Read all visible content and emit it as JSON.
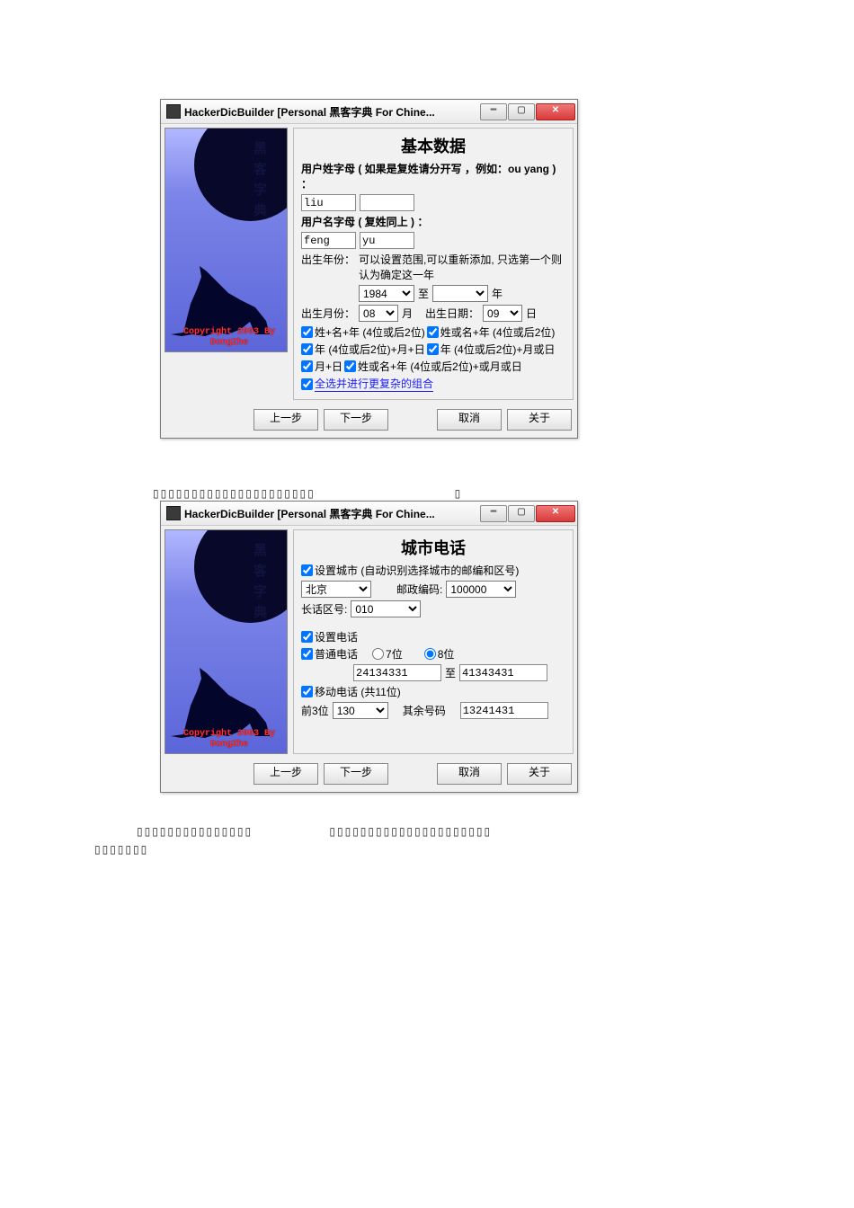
{
  "window_title": "HackerDicBuilder [Personal 黑客字典 For Chine...",
  "side_image": {
    "vertical_text": "黑客字典",
    "copyright_line1": "Copyright 2003 By",
    "copyright_line2": "DongZhe"
  },
  "buttons": {
    "prev": "上一步",
    "next": "下一步",
    "cancel": "取消",
    "about": "关于"
  },
  "win1": {
    "title": "基本数据",
    "surname_label": "用户姓字母 ( 如果是复姓请分开写 ，例如：ou yang ) ：",
    "surname_value": "liu",
    "name_label": "用户名字母 ( 复姓同上 ) ：",
    "name_value1": "feng",
    "name_value2": "yu",
    "birth_year_label": "出生年份：",
    "birth_year_note": "可以设置范围,可以重新添加, 只选第一个则认为确定这一年",
    "birth_year_from": "1984",
    "to": "至",
    "year_suffix": "年",
    "birth_month_label": "出生月份：",
    "birth_month_value": "08",
    "month_suffix": "月",
    "birth_day_label": "出生日期：",
    "birth_day_value": "09",
    "day_suffix": "日",
    "cb1": "姓+名+年 (4位或后2位)",
    "cb2": "姓或名+年 (4位或后2位)",
    "cb3": "年 (4位或后2位)+月+日",
    "cb4": "年 (4位或后2位)+月或日",
    "cb5": "月+日",
    "cb6": "姓或名+年 (4位或后2位)+或月或日",
    "cb7": "全选并进行更复杂的组合"
  },
  "win2": {
    "title": "城市电话",
    "set_city": "设置城市 (自动识别选择城市的邮编和区号)",
    "city_value": "北京",
    "postal_label": "邮政编码:",
    "postal_value": "100000",
    "area_label": "长话区号:",
    "area_value": "010",
    "set_phone": "设置电话",
    "normal_phone": "普通电话",
    "r7": "7位",
    "r8": "8位",
    "phone_from": "24134331",
    "to": "至",
    "phone_to": "41343431",
    "mobile_phone": "移动电话 (共11位)",
    "prefix3_label": "前3位",
    "prefix3_value": "130",
    "rest_label": "其余号码",
    "rest_value": "13241431"
  }
}
